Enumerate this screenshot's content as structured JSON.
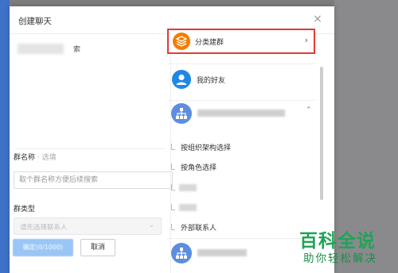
{
  "dialog": {
    "title": "创建聊天",
    "close_glyph": "×"
  },
  "left": {
    "search_tail": "索",
    "group_name_label": "群名称",
    "group_name_optional": " · 选填",
    "group_name_placeholder": "取个群名称方便后续搜索",
    "group_type_label": "群类型",
    "group_type_placeholder": "请先选择联系人",
    "create_button": "确定(0/1000)",
    "cancel_button": "取消"
  },
  "right": {
    "category_label": "分类建群",
    "category_chevron": "›",
    "friends_label": "我的好友",
    "org_chevron": "⌃",
    "sub_items": {
      "by_org": "按组织架构选择",
      "by_role": "按角色选择",
      "external": "外部联系人"
    }
  },
  "watermark": {
    "top": "百科全说",
    "bottom": "助你轻松解决"
  },
  "colors": {
    "primary_blue": "#1e88e5",
    "category_orange": "#f57c00",
    "highlight_red": "#e53935",
    "watermark_green": "#1ea456"
  }
}
